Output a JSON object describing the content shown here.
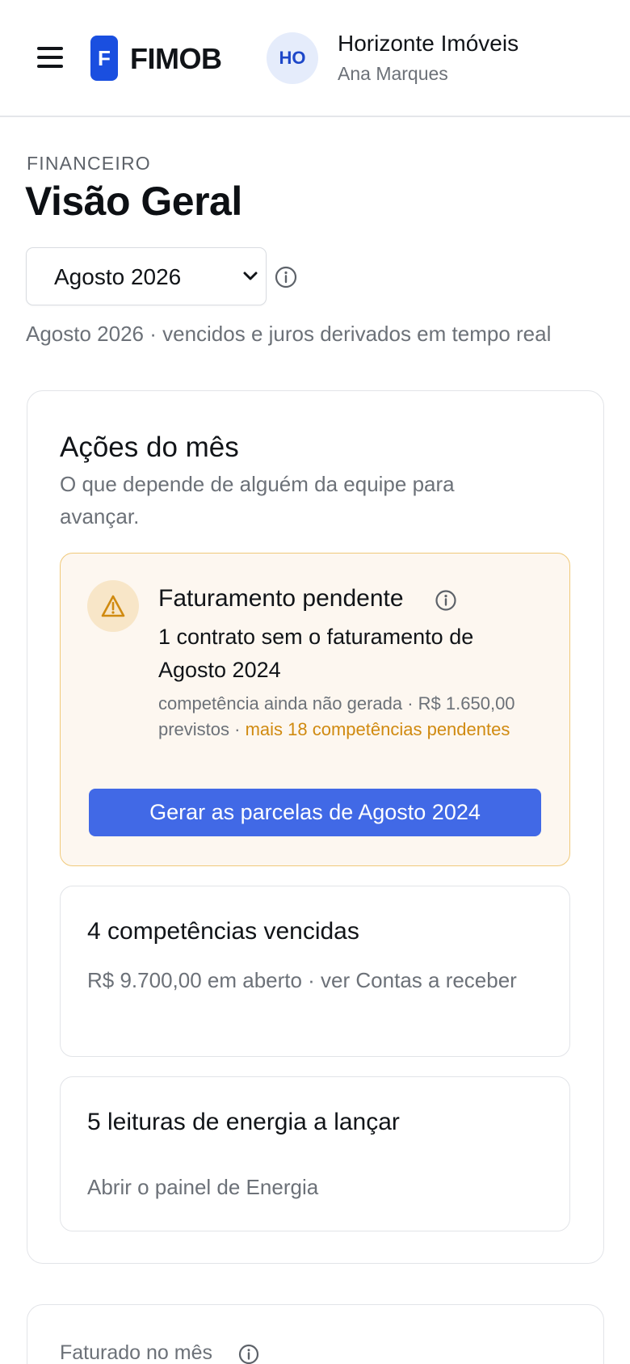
{
  "header": {
    "logo_letter": "F",
    "brand": "FIMOB",
    "avatar_initials": "HO",
    "org_name": "Horizonte Imóveis",
    "user_name": "Ana Marques"
  },
  "page": {
    "eyebrow": "FINANCEIRO",
    "title": "Visão Geral",
    "month_selected": "Agosto 2026",
    "subline": "Agosto 2026 · vencidos e juros derivados em tempo real"
  },
  "actions": {
    "title": "Ações do mês",
    "subtitle": "O que depende de alguém da equipe para avançar.",
    "billing": {
      "title": "Faturamento pendente",
      "text": "1 contrato sem o faturamento de Agosto 2024",
      "meta": "competência ainda não gerada · R$ 1.650,00 previstos · ",
      "meta_link": "mais 18 competências pendentes",
      "button": "Gerar as parcelas de Agosto 2024"
    },
    "overdue": {
      "title": "4 competências vencidas",
      "desc": "R$ 9.700,00 em aberto · ver Contas a receber"
    },
    "energy": {
      "title": "5 leituras de energia a lançar",
      "desc": "Abrir o painel de Energia"
    }
  },
  "summary": {
    "label": "Faturado no mês"
  },
  "colors": {
    "brand": "#1a4fe0",
    "primary_button": "#4169e6",
    "warning_border": "#f0c97a",
    "warning_bg": "#fdf7f0",
    "warning_accent": "#d08a10"
  },
  "icons": {
    "menu": "hamburger-menu-icon",
    "dropdown": "chevron-down-icon",
    "info": "info-circle-icon",
    "warning": "warning-triangle-icon"
  }
}
